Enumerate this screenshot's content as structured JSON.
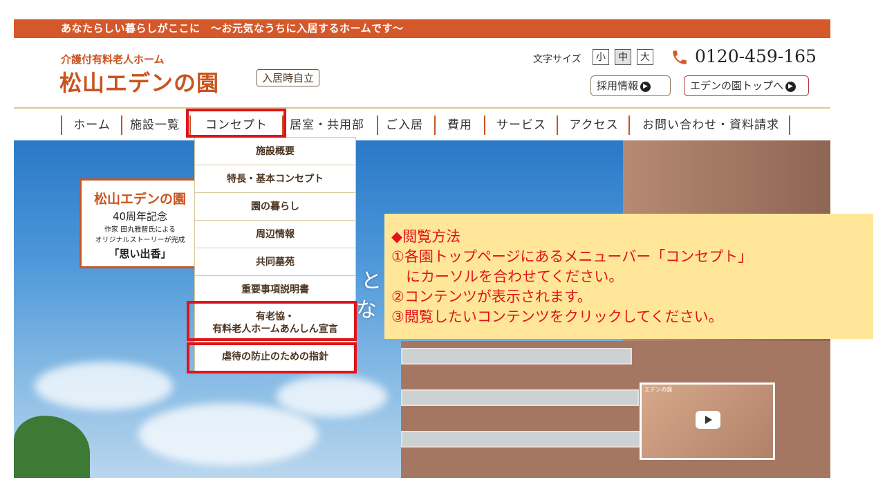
{
  "site": {
    "tagline": "あなたらしい暮らしがここに　～お元気なうちに入居するホームです～",
    "logo_sub": "介護付有料老人ホーム",
    "logo_main": "松山エデンの園",
    "logo_badge": "入居時自立",
    "font_size": {
      "label": "文字サイズ",
      "small": "小",
      "medium": "中",
      "large": "大"
    },
    "phone": "0120-459-165",
    "recruit_button": "採用情報",
    "eden_top_button": "エデンの園トップへ"
  },
  "nav": {
    "items": [
      "ホーム",
      "施設一覧",
      "コンセプト",
      "居室・共用部",
      "ご入居",
      "費用",
      "サービス",
      "アクセス",
      "お問い合わせ・資料請求"
    ]
  },
  "dropdown": {
    "items": [
      "施設概要",
      "特長・基本コンセプト",
      "園の暮らし",
      "周辺情報",
      "共同墓苑",
      "重要事項説明書",
      "有老協・",
      "有料老人ホームあんしん宣言",
      "虐待の防止のための指針"
    ]
  },
  "hero": {
    "ribbon_title": "松山エデンの園",
    "ribbon_anniv": "40周年記念",
    "ribbon_line1": "作家 田丸雅智氏による",
    "ribbon_line2": "オリジナルストーリーが完成",
    "ribbon_story": "「思い出香」",
    "text_fragment1": "と",
    "text_fragment2": "な",
    "video_label": "エデンの園"
  },
  "note": {
    "line1": "◆閲覧方法",
    "line2": "①各園トップページにあるメニューバー「コンセプト」",
    "line3": "　にカーソルを合わせてください。",
    "line4": "②コンテンツが表示されます。",
    "line5": "③閲覧したいコンテンツをクリックしてください。"
  },
  "colors": {
    "brand": "#d4582a",
    "highlight": "#e0141b",
    "note_bg": "#ffe699"
  },
  "icons": [
    "phone-icon",
    "chevron-right-icon",
    "play-icon"
  ]
}
